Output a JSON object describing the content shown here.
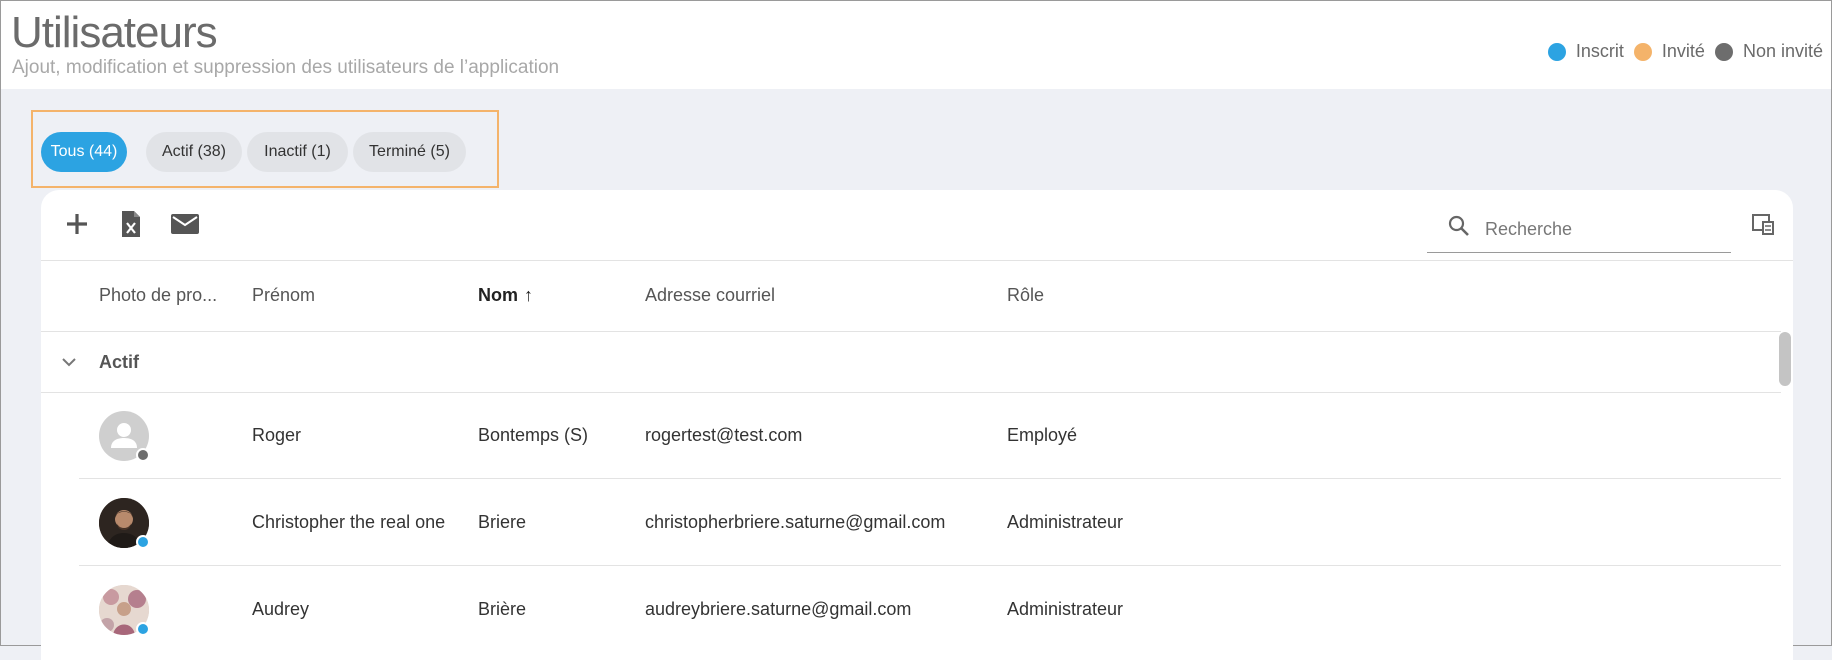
{
  "header": {
    "title": "Utilisateurs",
    "subtitle": "Ajout, modification et suppression des utilisateurs de l’application"
  },
  "legend": [
    {
      "label": "Inscrit",
      "color": "#2ca3e2"
    },
    {
      "label": "Invité",
      "color": "#f4b36a"
    },
    {
      "label": "Non invité",
      "color": "#6d6d6d"
    }
  ],
  "tabs": [
    {
      "label": "Tous (44)",
      "active": true
    },
    {
      "label": "Actif (38)",
      "active": false
    },
    {
      "label": "Inactif (1)",
      "active": false
    },
    {
      "label": "Terminé (5)",
      "active": false
    }
  ],
  "toolbar": {
    "add_icon": "plus-icon",
    "export_icon": "excel-file-icon",
    "email_icon": "mail-icon",
    "search_placeholder": "Recherche",
    "columns_icon": "column-chooser-icon"
  },
  "columns": {
    "photo": "Photo de pro...",
    "first_name": "Prénom",
    "last_name": "Nom",
    "last_name_sort": "↑",
    "email": "Adresse courriel",
    "role": "Rôle"
  },
  "group": {
    "label": "Actif"
  },
  "rows": [
    {
      "first_name": "Roger",
      "last_name": "Bontemps (S)",
      "email": "rogertest@test.com",
      "role": "Employé",
      "status_color": "#6d6d6d",
      "avatar": "default-avatar-icon"
    },
    {
      "first_name": "Christopher the real one",
      "last_name": "Briere",
      "email": "christopherbriere.saturne@gmail.com",
      "role": "Administrateur",
      "status_color": "#2ca3e2",
      "avatar": "photo-avatar"
    },
    {
      "first_name": "Audrey",
      "last_name": "Brière",
      "email": "audreybriere.saturne@gmail.com",
      "role": "Administrateur",
      "status_color": "#2ca3e2",
      "avatar": "photo-avatar"
    }
  ]
}
